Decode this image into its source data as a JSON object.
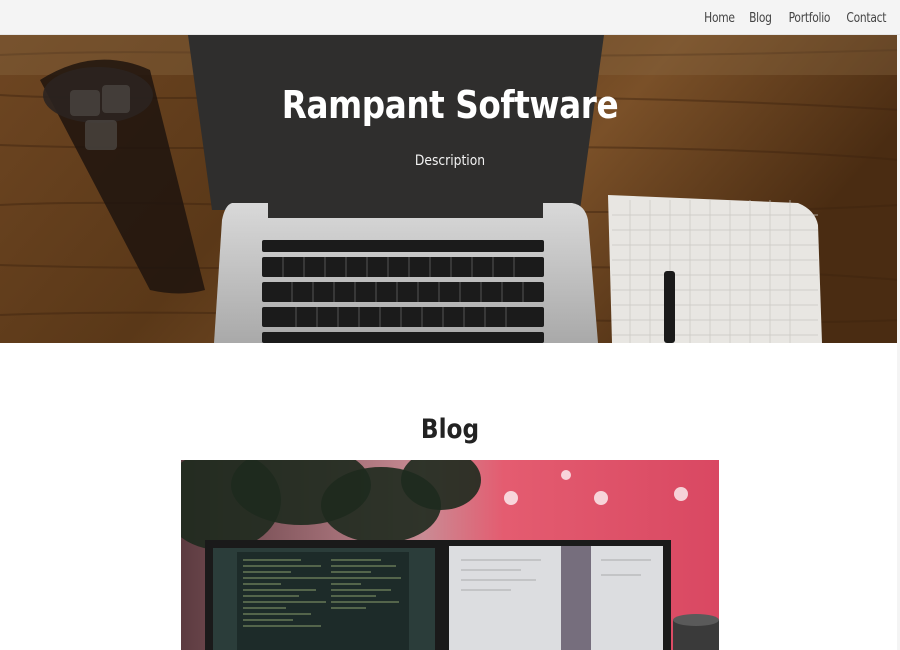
{
  "nav": {
    "items": [
      {
        "label": "Home"
      },
      {
        "label": "Blog"
      },
      {
        "label": "Portfolio"
      },
      {
        "label": "Contact"
      }
    ]
  },
  "hero": {
    "title": "Rampant Software",
    "description": "Description"
  },
  "blog": {
    "heading": "Blog"
  },
  "colors": {
    "nav_bg": "#f4f4f4",
    "hero_text": "#ffffff",
    "accent_pink": "#e0566e"
  }
}
